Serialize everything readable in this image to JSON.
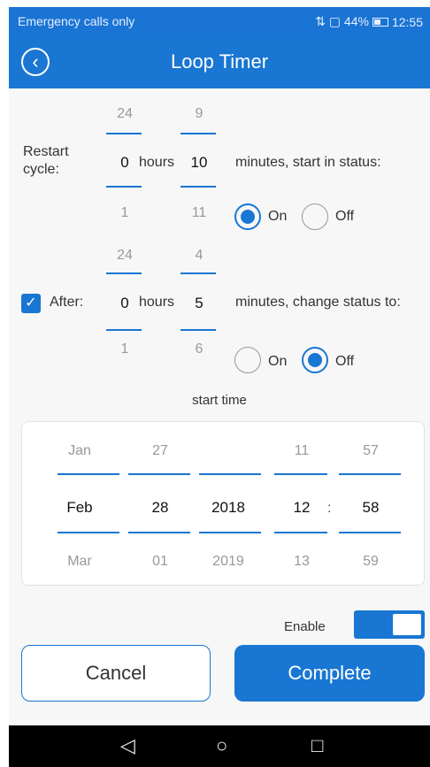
{
  "status_bar": {
    "carrier": "Emergency calls only",
    "indicators": "⇅ ▢ 44%",
    "time": "12:55"
  },
  "app_bar": {
    "title": "Loop Timer",
    "back_icon": "back-arrow-circle-icon"
  },
  "restart": {
    "label": "Restart\ncycle:",
    "hours_above": "24",
    "hours_value": "0",
    "hours_below": "1",
    "hours_unit": "hours",
    "minutes_above": "9",
    "minutes_value": "10",
    "minutes_below": "11",
    "suffix": "minutes, start in status:",
    "on_label": "On",
    "off_label": "Off",
    "selected": "On"
  },
  "after": {
    "checked": true,
    "label": "After:",
    "hours_above": "24",
    "hours_value": "0",
    "hours_below": "1",
    "hours_unit": "hours",
    "minutes_above": "4",
    "minutes_value": "5",
    "minutes_below": "6",
    "suffix": "minutes, change status to:",
    "on_label": "On",
    "off_label": "Off",
    "selected": "Off"
  },
  "start_time": {
    "label": "start time",
    "month": {
      "above": "Jan",
      "value": "Feb",
      "below": "Mar"
    },
    "day": {
      "above": "27",
      "value": "28",
      "below": "01"
    },
    "year": {
      "above": "",
      "value": "2018",
      "below": "2019"
    },
    "hour": {
      "above": "11",
      "value": "12",
      "below": "13"
    },
    "minute": {
      "above": "57",
      "value": "58",
      "below": "59"
    },
    "separator": ":"
  },
  "enable": {
    "label": "Enable",
    "on": true
  },
  "actions": {
    "cancel": "Cancel",
    "complete": "Complete"
  },
  "nav": {
    "back": "◁",
    "home": "○",
    "recent": "□"
  },
  "colors": {
    "primary": "#1976d2",
    "status_bar": "#1a74d4"
  }
}
